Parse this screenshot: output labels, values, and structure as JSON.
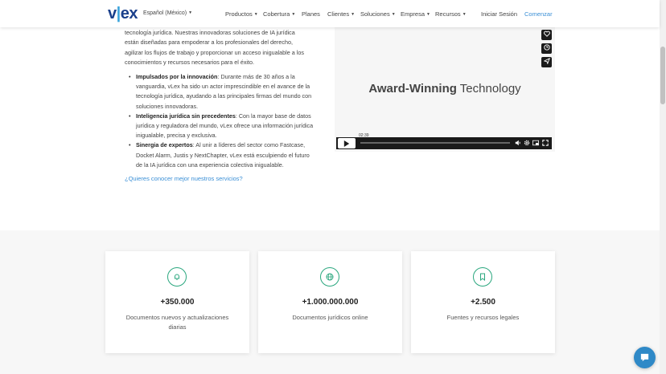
{
  "header": {
    "logo_main": "v",
    "logo_accent": "|",
    "logo_rest": "ex",
    "language": "Español (México)",
    "nav": [
      "Productos",
      "Cobertura",
      "Planes",
      "Clientes",
      "Soluciones",
      "Empresa",
      "Recursos"
    ],
    "login": "Iniciar Sesión",
    "start": "Comenzar"
  },
  "content": {
    "intro": "tecnología jurídica. Nuestras innovadoras soluciones de IA jurídica están diseñadas para empoderar a los profesionales del derecho, agilizar los flujos de trabajo y proporcionar un acceso inigualable a los conocimientos y recursos necesarios para el éxito.",
    "bullets": [
      {
        "title": "Impulsados por la innovación",
        "text": ": Durante más de 30 años a la vanguardia, vLex ha sido un actor imprescindible en el avance de la tecnología jurídica, ayudando a las principales firmas del mundo con soluciones innovadoras."
      },
      {
        "title": "Inteligencia jurídica sin precedentes",
        "text": ": Con la mayor base de datos jurídica y reguladora del mundo, vLex ofrece una información jurídica inigualable, precisa y exclusiva."
      },
      {
        "title": "Sinergia de expertos",
        "text": ": Al unir a líderes del sector como Fastcase, Docket Alarm, Justis y NextChapter, vLex está esculpiendo el futuro de la IA jurídica con una experiencia colectiva inigualable."
      }
    ],
    "more_link": "¿Quieres conocer mejor nuestros servicios?"
  },
  "video": {
    "title_bold": "Award-Winning",
    "title_rest": " Technology",
    "timecode": "02:39",
    "progress": 0
  },
  "stats": [
    {
      "icon": "bell-icon",
      "value": "+350.000",
      "label": "Documentos nuevos y actualizaciones diarias"
    },
    {
      "icon": "globe-icon",
      "value": "+1.000.000.000",
      "label": "Documentos jurídicos online"
    },
    {
      "icon": "bookmark-icon",
      "value": "+2.500",
      "label": "Fuentes y recursos legales"
    }
  ],
  "colors": {
    "brand": "#1a3f8b",
    "accent": "#3aa4dc",
    "link": "#3a8fd6",
    "icon_ring": "#2aa77e",
    "chat": "#2f89c7"
  }
}
